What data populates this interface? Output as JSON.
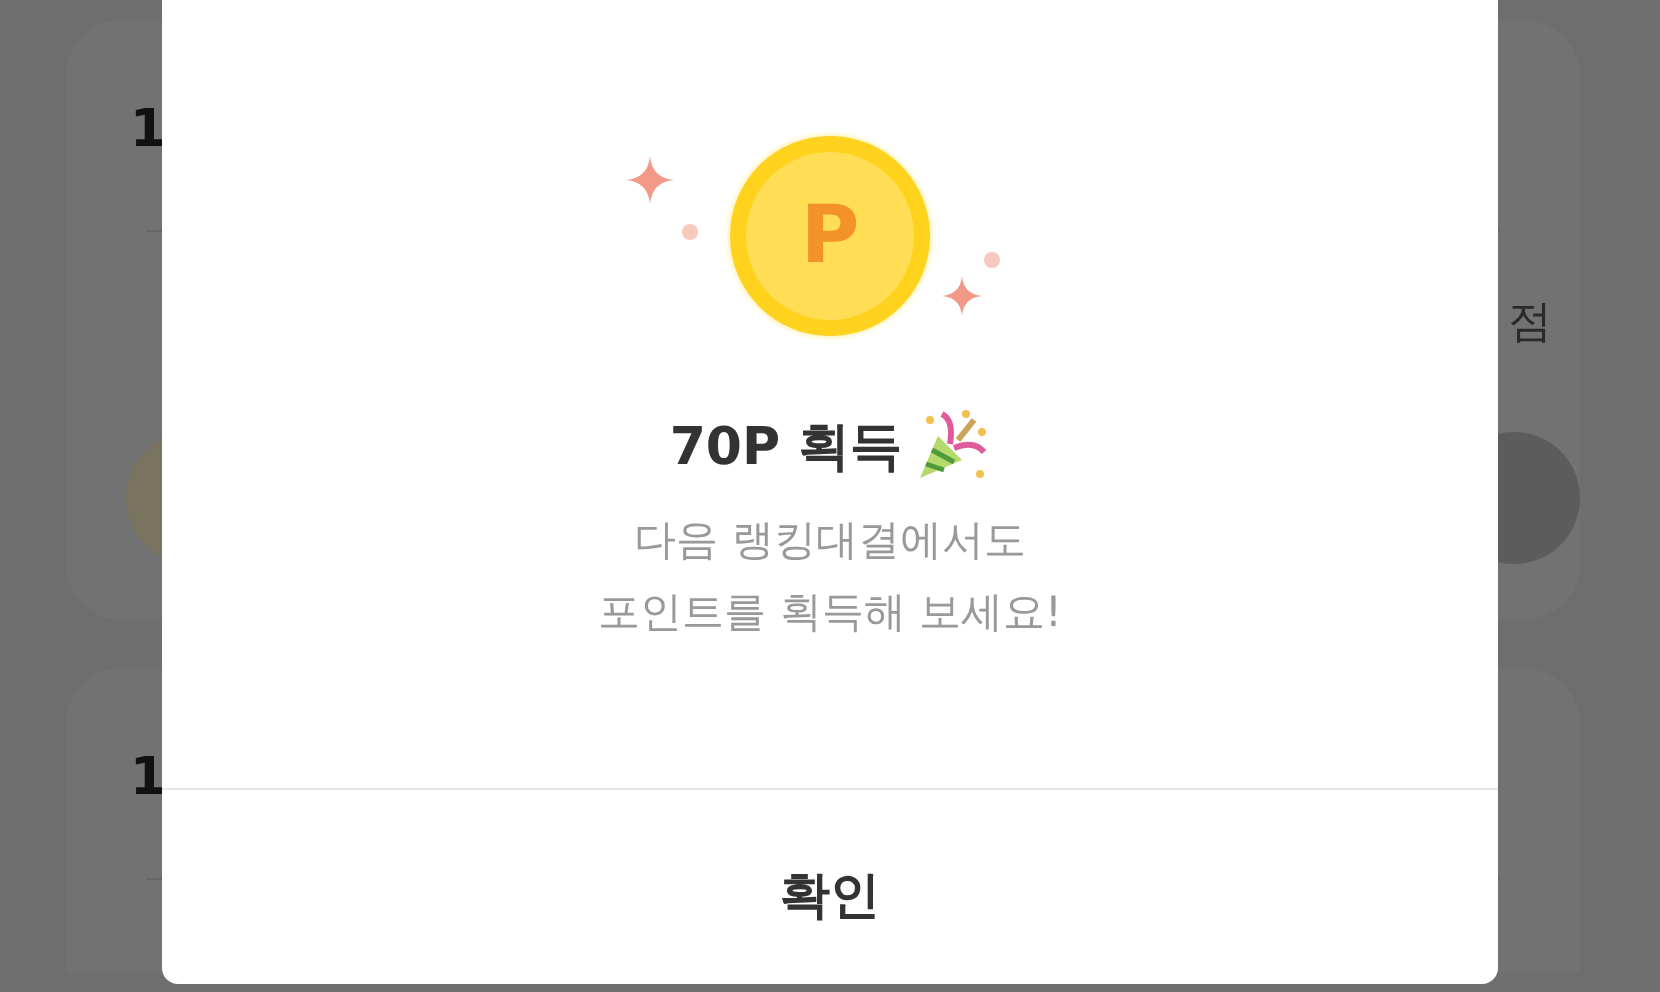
{
  "background_cards": [
    {
      "rank": "1",
      "score_unit": "점"
    },
    {
      "rank": "1"
    }
  ],
  "dialog": {
    "coin_letter": "P",
    "title": "70P 획득",
    "message_lines": [
      "다음 랭킹대결에서도",
      "포인트를 획득해 보세요!"
    ],
    "confirm_button": "확인"
  }
}
